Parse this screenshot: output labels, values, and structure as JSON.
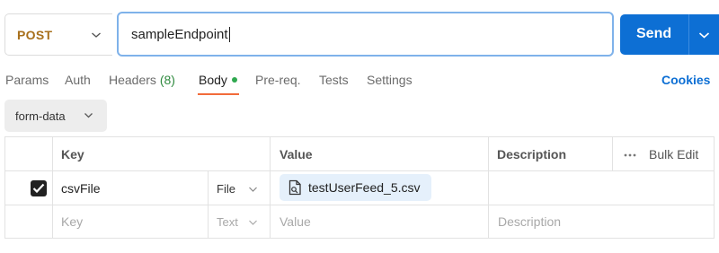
{
  "request": {
    "method": "POST",
    "url": "sampleEndpoint",
    "send_label": "Send"
  },
  "tabs": [
    {
      "label": "Params"
    },
    {
      "label": "Auth"
    },
    {
      "label": "Headers",
      "count": "(8)"
    },
    {
      "label": "Body",
      "active": true,
      "has_content": true
    },
    {
      "label": "Pre-req."
    },
    {
      "label": "Tests"
    },
    {
      "label": "Settings"
    }
  ],
  "cookies_label": "Cookies",
  "body_type": "form-data",
  "table": {
    "columns": {
      "key": "Key",
      "value": "Value",
      "description": "Description",
      "bulk_edit": "Bulk Edit"
    },
    "rows": [
      {
        "checked": true,
        "key": "csvFile",
        "type": "File",
        "value": "testUserFeed_5.csv",
        "description": ""
      }
    ],
    "placeholder_row": {
      "key": "Key",
      "type": "Text",
      "value": "Value",
      "description": "Description"
    }
  },
  "colors": {
    "method_post": "#a8701c",
    "send_button": "#0d6fd4",
    "active_tab_underline": "#f26b3a",
    "body_dot": "#2fa84f",
    "headers_count": "#2f8a3f",
    "file_chip_bg": "#e5f0fb",
    "url_focus_border": "#7fb2ea"
  },
  "icons": {
    "method_dropdown": "chevron-down-icon",
    "send_dropdown": "chevron-down-icon",
    "checkbox": "check-icon",
    "file": "file-icon",
    "more": "more-horizontal-icon"
  }
}
